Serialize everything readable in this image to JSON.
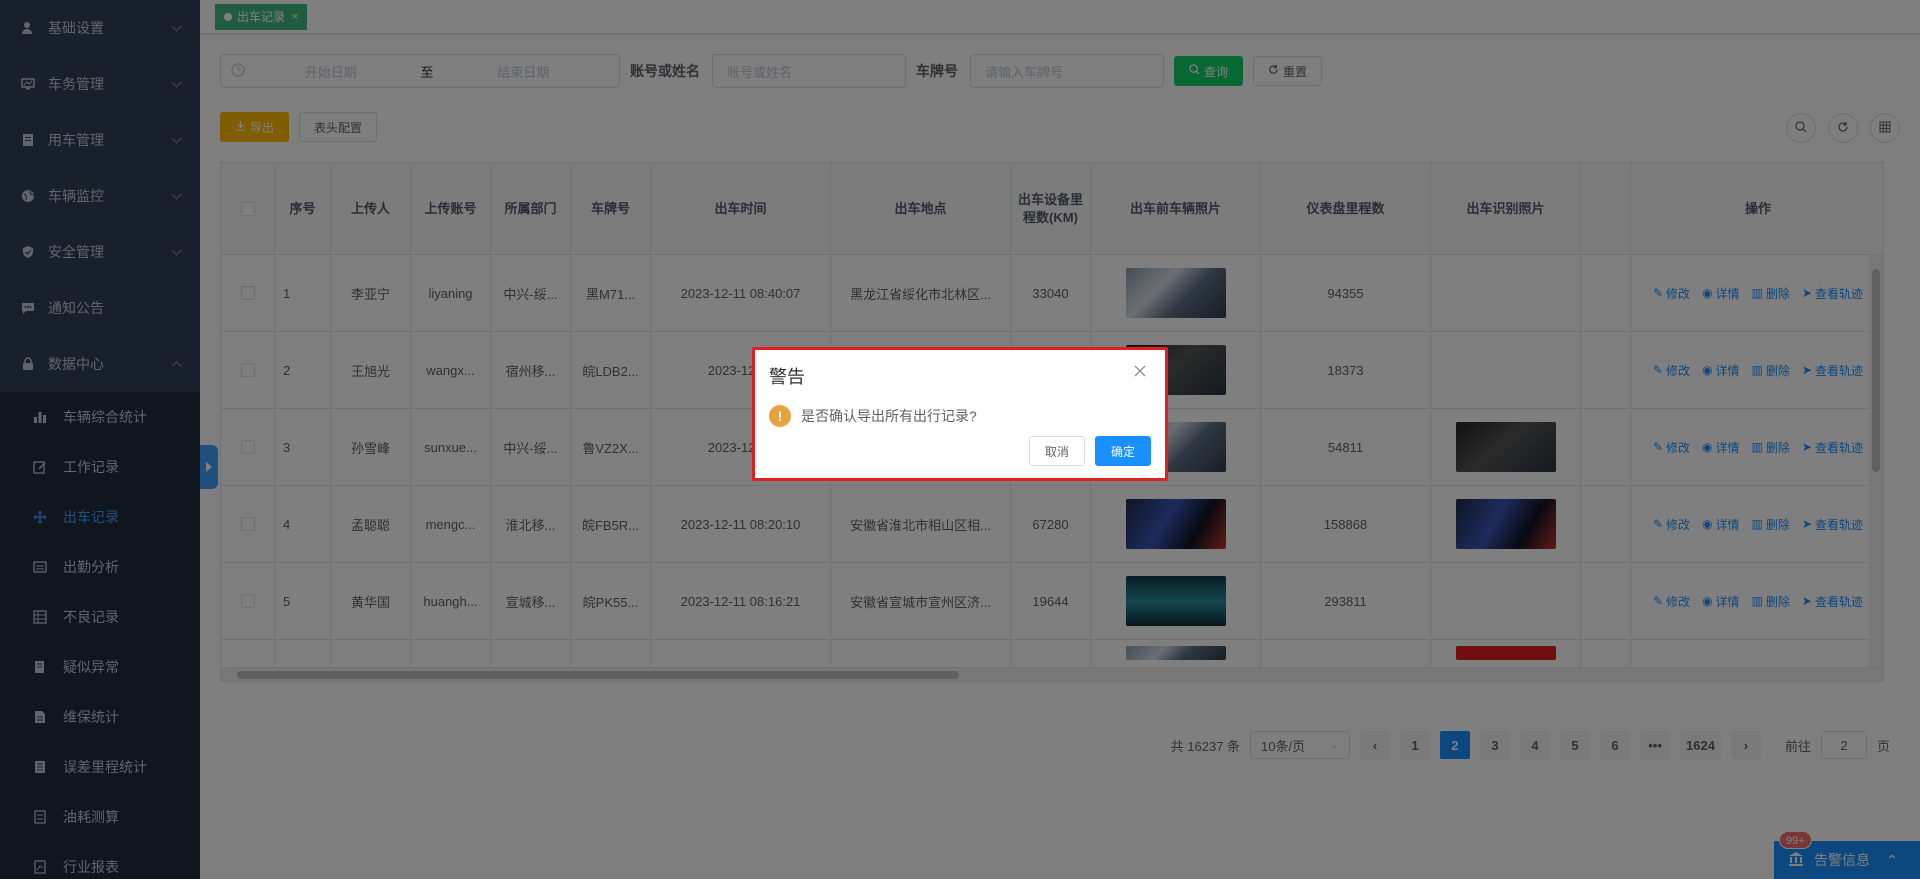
{
  "sidebar": {
    "menus": [
      {
        "label": "基础设置",
        "icon": "user-icon"
      },
      {
        "label": "车务管理",
        "icon": "monitor-icon"
      },
      {
        "label": "用车管理",
        "icon": "document-icon"
      },
      {
        "label": "车辆监控",
        "icon": "globe-icon"
      },
      {
        "label": "安全管理",
        "icon": "shield-icon"
      },
      {
        "label": "通知公告",
        "icon": "message-icon"
      },
      {
        "label": "数据中心",
        "icon": "lock-icon"
      }
    ],
    "sub_items": [
      {
        "label": "车辆综合统计",
        "icon": "bar-chart-icon"
      },
      {
        "label": "工作记录",
        "icon": "edit-icon"
      },
      {
        "label": "出车记录",
        "icon": "move-icon"
      },
      {
        "label": "出勤分析",
        "icon": "calendar-icon"
      },
      {
        "label": "不良记录",
        "icon": "table-icon"
      },
      {
        "label": "疑似异常",
        "icon": "book-icon"
      },
      {
        "label": "维保统计",
        "icon": "file-icon"
      },
      {
        "label": "误差里程统计",
        "icon": "file-icon"
      },
      {
        "label": "油耗测算",
        "icon": "file-icon"
      },
      {
        "label": "行业报表",
        "icon": "file-icon"
      }
    ]
  },
  "tab": {
    "label": "出车记录",
    "close": "×"
  },
  "search": {
    "start_placeholder": "开始日期",
    "sep": "至",
    "end_placeholder": "结束日期",
    "account_label": "账号或姓名",
    "account_placeholder": "账号或姓名",
    "plate_label": "车牌号",
    "plate_placeholder": "请输入车牌号",
    "query_label": "查询",
    "reset_label": "重置"
  },
  "toolbar": {
    "export_label": "导出",
    "header_config_label": "表头配置"
  },
  "table": {
    "headers": [
      "序号",
      "上传人",
      "上传账号",
      "所属部门",
      "车牌号",
      "出车时间",
      "出车地点",
      "出车设备里程数(KM)",
      "出车前车辆照片",
      "仪表盘里程数",
      "出车识别照片",
      "",
      "操作"
    ],
    "rows": [
      {
        "idx": "1",
        "uploader": "李亚宁",
        "account": "liyaning",
        "dept": "中兴-绥...",
        "plate": "黑M71...",
        "time": "2023-12-11 08:40:07",
        "place": "黑龙江省绥化市北林区...",
        "device_km": "33040",
        "dash_km": "94355"
      },
      {
        "idx": "2",
        "uploader": "王旭光",
        "account": "wangx...",
        "dept": "宿州移...",
        "plate": "皖LDB2...",
        "time": "2023-12-11",
        "place": "",
        "device_km": "",
        "dash_km": "18373"
      },
      {
        "idx": "3",
        "uploader": "孙雪峰",
        "account": "sunxue...",
        "dept": "中兴-绥...",
        "plate": "鲁VZ2X...",
        "time": "2023-12-11",
        "place": "",
        "device_km": "",
        "dash_km": "54811"
      },
      {
        "idx": "4",
        "uploader": "孟聪聪",
        "account": "mengc...",
        "dept": "淮北移...",
        "plate": "皖FB5R...",
        "time": "2023-12-11 08:20:10",
        "place": "安徽省淮北市相山区相...",
        "device_km": "67280",
        "dash_km": "158868"
      },
      {
        "idx": "5",
        "uploader": "黄华国",
        "account": "huangh...",
        "dept": "宣城移...",
        "plate": "皖PK55...",
        "time": "2023-12-11 08:16:21",
        "place": "安徽省宣城市宣州区济...",
        "device_km": "19644",
        "dash_km": "293811"
      }
    ],
    "ops": {
      "edit": "修改",
      "detail": "详情",
      "delete": "删除",
      "track": "查看轨迹"
    }
  },
  "pagination": {
    "total": "共 16237 条",
    "page_size": "10条/页",
    "pages": [
      "1",
      "2",
      "3",
      "4",
      "5",
      "6"
    ],
    "more": "•••",
    "last": "1624",
    "goto_label": "前往",
    "goto_value": "2",
    "page_suffix": "页"
  },
  "alarm": {
    "badge": "99+",
    "label": "告警信息"
  },
  "dialog": {
    "title": "警告",
    "message": "是否确认导出所有出行记录?",
    "cancel": "取消",
    "confirm": "确定"
  },
  "colors": {
    "primary": "#1890ff",
    "sidebar": "#304156",
    "danger_border": "#e02020",
    "warning": "#e6a23c"
  }
}
